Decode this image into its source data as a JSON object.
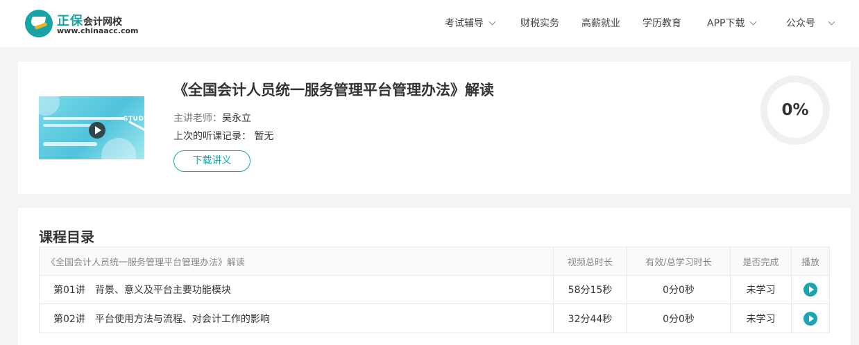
{
  "brand": {
    "name": "正保",
    "subtitle": "会计网校",
    "url": "www.chinaacc.com"
  },
  "nav": {
    "items": [
      {
        "label": "考试辅导",
        "dropdown": true
      },
      {
        "label": "财税实务",
        "dropdown": false
      },
      {
        "label": "高薪就业",
        "dropdown": false
      },
      {
        "label": "学历教育",
        "dropdown": false
      },
      {
        "label": "APP下载",
        "dropdown": true
      },
      {
        "label": "公众号",
        "dropdown": true
      }
    ]
  },
  "course": {
    "title": "《全国会计人员统一服务管理平台管理办法》解读",
    "teacher_label": "主讲老师：",
    "teacher": "吴永立",
    "last_record_label": "上次的听课记录：",
    "last_record": "暂无",
    "download_label": "下载讲义",
    "progress": "0%",
    "thumbnail": {
      "badge_text": "STUDY"
    }
  },
  "catalog": {
    "title": "课程目录",
    "header": {
      "name": "《全国会计人员统一服务管理平台管理办法》解读",
      "video_duration": "视频总时长",
      "study_duration": "有效/总学习时长",
      "completed": "是否完成",
      "play": "播放"
    },
    "lessons": [
      {
        "no": "第01讲",
        "name": "背景、意义及平台主要功能模块",
        "video_duration": "58分15秒",
        "study_duration": "0分0秒",
        "status": "未学习"
      },
      {
        "no": "第02讲",
        "name": "平台使用方法与流程、对会计工作的影响",
        "video_duration": "32分44秒",
        "study_duration": "0分0秒",
        "status": "未学习"
      }
    ]
  },
  "colors": {
    "accent": "#1aa4a8",
    "play_button": "#1aa4b4",
    "page_bg": "#f3f4f5"
  }
}
